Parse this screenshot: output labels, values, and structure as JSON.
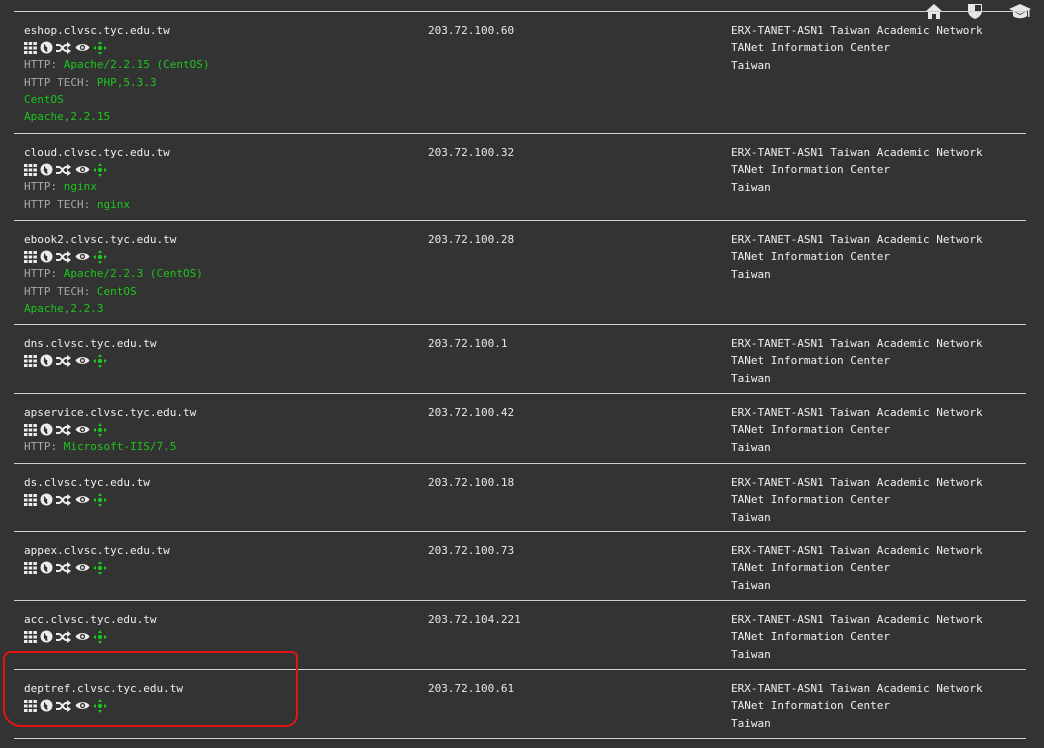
{
  "nav": {
    "icons": [
      "home-icon",
      "shield-icon",
      "graduation-cap-icon"
    ]
  },
  "colors": {
    "background": "#333333",
    "text": "#f0f0f0",
    "accent_green": "#1cc71c",
    "label_gray": "#a8a8a8",
    "highlight_red": "#e01616"
  },
  "action_icons": [
    "grid-icon",
    "globe-icon",
    "shuffle-icon",
    "eye-icon",
    "crosshair-icon"
  ],
  "rows": [
    {
      "host": "eshop.clvsc.tyc.edu.tw",
      "ip": "203.72.100.60",
      "http_label": "HTTP:",
      "http_value": "Apache/2.2.15 (CentOS)",
      "tech_label": "HTTP TECH:",
      "tech_value": "PHP,5.3.3",
      "extra1": "CentOS",
      "extra2": "Apache,2.2.15",
      "asn": "ERX-TANET-ASN1 Taiwan Academic Network",
      "org": "TANet Information Center",
      "country": "Taiwan"
    },
    {
      "host": "cloud.clvsc.tyc.edu.tw",
      "ip": "203.72.100.32",
      "http_label": "HTTP:",
      "http_value": "nginx",
      "tech_label": "HTTP TECH:",
      "tech_value": "nginx",
      "asn": "ERX-TANET-ASN1 Taiwan Academic Network",
      "org": "TANet Information Center",
      "country": "Taiwan"
    },
    {
      "host": "ebook2.clvsc.tyc.edu.tw",
      "ip": "203.72.100.28",
      "http_label": "HTTP:",
      "http_value": "Apache/2.2.3 (CentOS)",
      "tech_label": "HTTP TECH:",
      "tech_value": "CentOS",
      "extra1": "Apache,2.2.3",
      "asn": "ERX-TANET-ASN1 Taiwan Academic Network",
      "org": "TANet Information Center",
      "country": "Taiwan"
    },
    {
      "host": "dns.clvsc.tyc.edu.tw",
      "ip": "203.72.100.1",
      "asn": "ERX-TANET-ASN1 Taiwan Academic Network",
      "org": "TANet Information Center",
      "country": "Taiwan"
    },
    {
      "host": "apservice.clvsc.tyc.edu.tw",
      "ip": "203.72.100.42",
      "http_label": "HTTP:",
      "http_value": "Microsoft-IIS/7.5",
      "asn": "ERX-TANET-ASN1 Taiwan Academic Network",
      "org": "TANet Information Center",
      "country": "Taiwan"
    },
    {
      "host": "ds.clvsc.tyc.edu.tw",
      "ip": "203.72.100.18",
      "asn": "ERX-TANET-ASN1 Taiwan Academic Network",
      "org": "TANet Information Center",
      "country": "Taiwan"
    },
    {
      "host": "appex.clvsc.tyc.edu.tw",
      "ip": "203.72.100.73",
      "asn": "ERX-TANET-ASN1 Taiwan Academic Network",
      "org": "TANet Information Center",
      "country": "Taiwan"
    },
    {
      "host": "acc.clvsc.tyc.edu.tw",
      "ip": "203.72.104.221",
      "asn": "ERX-TANET-ASN1 Taiwan Academic Network",
      "org": "TANet Information Center",
      "country": "Taiwan"
    },
    {
      "host": "deptref.clvsc.tyc.edu.tw",
      "ip": "203.72.100.61",
      "asn": "ERX-TANET-ASN1 Taiwan Academic Network",
      "org": "TANet Information Center",
      "country": "Taiwan"
    }
  ]
}
